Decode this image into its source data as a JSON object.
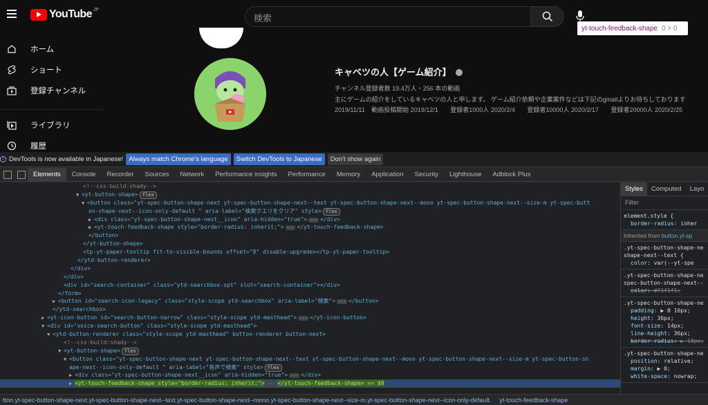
{
  "youtube": {
    "logo_text": "YouTube",
    "country": "JP",
    "search_placeholder": "検索",
    "tooltip": {
      "tag": "yt-touch-feedback-shape",
      "size": "0 × 0"
    },
    "nav": [
      {
        "label": "ホーム",
        "icon": "home-icon"
      },
      {
        "label": "ショート",
        "icon": "shorts-icon"
      },
      {
        "label": "登録チャンネル",
        "icon": "subscriptions-icon"
      },
      {
        "label": "ライブラリ",
        "icon": "library-icon"
      },
      {
        "label": "履歴",
        "icon": "history-icon"
      }
    ],
    "channel": {
      "name": "キャベツの人【ゲーム紹介】",
      "stats": "チャンネル登録者数 19.4万人・256 本の動画",
      "description": "主にゲームの紹介をしているキャベツの人と申します。 ゲーム紹介依頼や企業案件などは下記のgmailよりお待ちしております",
      "dates": [
        "2019/11/11",
        "動画投稿開始 2019/12/1",
        "登録者1000人 2020/2/4",
        "登録者10000人 2020/2/17",
        "登録者20000人 2020/2/25"
      ]
    }
  },
  "devtools": {
    "infobar": {
      "message": "DevTools is now available in Japanese!",
      "btn_match": "Always match Chrome's language",
      "btn_switch": "Switch DevTools to Japanese",
      "btn_dismiss": "Don't show again"
    },
    "tabs": [
      "Elements",
      "Console",
      "Recorder",
      "Sources",
      "Network",
      "Performance insights",
      "Performance",
      "Memory",
      "Application",
      "Security",
      "Lighthouse",
      "Adblock Plus"
    ],
    "styles_tabs": [
      "Styles",
      "Computed",
      "Layo"
    ],
    "filter_placeholder": "Filter",
    "breadcrumbs": {
      "c1": "tton.yt-spec-button-shape-next.yt-spec-button-shape-next--text.yt-spec-button-shape-next--mono.yt-spec-button-shape-next--size-m.yt-spec-button-shape-next--icon-only-default.",
      "c2": "yt-touch-feedback-shape"
    },
    "dom_lines": [
      "<!--css-build:shady-->",
      "<yt-button-shape>",
      "<button class=\"yt-spec-button-shape-next yt-spec-button-shape-next--text yt-spec-button-shape-next--mono yt-spec-button-shape-next--size-m yt-spec-butt",
      "on-shape-next--icon-only-default \" aria-label=\"検索クエリをクリア\" style>",
      "<div class=\"yt-spec-button-shape-next__icon\" aria-hidden=\"true\">",
      "<yt-touch-feedback-shape style=\"border-radius: inherit;\">",
      "</button>",
      "</yt-button-shape>",
      "<tp-yt-paper-tooltip fit-to-visible-bounds offset=\"8\" disable-upgrade></tp-yt-paper-tooltip>",
      "</ytd-button-renderer>",
      "</div>",
      "</div>",
      "<div id=\"search-container\" class=\"ytd-searchbox-spt\" slot=\"search-container\"></div>",
      "</form>",
      "<button id=\"search-icon-legacy\" class=\"style-scope ytd-searchbox\" aria-label=\"検索\">",
      "</ytd-searchbox>",
      "<yt-icon-button id=\"search-button-narrow\" class=\"style-scope ytd-masthead\">",
      "<div id=\"voice-search-button\" class=\"style-scope ytd-masthead\">",
      "<ytd-button-renderer class=\"style-scope ytd-masthead\" button-renderer button-next>",
      "<!--css-build:shady-->",
      "<yt-button-shape>",
      "<button class=\"yt-spec-button-shape-next yt-spec-button-shape-next--text yt-spec-button-shape-next--mono yt-spec-button-shape-next--size-m yt-spec-button-sh",
      "ape-next--icon-only-default \" aria-label=\"音声で検索\" style>",
      "<div class=\"yt-spec-button-shape-next__icon\" aria-hidden=\"true\">",
      "<yt-touch-feedback-shape style=\"border-radius: inherit;\">",
      "</yt-touch-feedback-shape> == $0"
    ],
    "styles_rules": {
      "element_style": "element.style {",
      "er_prop": "border-radius:",
      "er_val": "inher",
      "inherited": "Inherited from",
      "inherited_sel": "button.yt-sp",
      "r1_sel": ".yt-spec-button-shape-ne",
      "r1_sel2": "shape-next--text {",
      "r1_prop": "color:",
      "r1_val": "var(--yt-spe",
      "r2_sel": ".yt-spec-button-shape-ne",
      "r2_sel2": "spec-button-shape-next--",
      "r2_prop": "color:",
      "r2_val": "#f1f1f1;",
      "r3_sel": ".yt-spec-button-shape-ne",
      "r3_p1": "padding:",
      "r3_v1": "▶ 0 16px;",
      "r3_p2": "height:",
      "r3_v2": "36px;",
      "r3_p3": "font-size:",
      "r3_v3": "14px;",
      "r3_p4": "line-height:",
      "r3_v4": "36px;",
      "r3_p5": "border-radius:",
      "r3_v5": "▶ 18px;",
      "r4_sel": ".yt-spec-button-shape-ne",
      "r4_p1": "position:",
      "r4_v1": "relative;",
      "r4_p2": "margin:",
      "r4_v2": "▶ 0;",
      "r4_p3": "white-space:",
      "r4_v3": "nowrap;"
    }
  }
}
